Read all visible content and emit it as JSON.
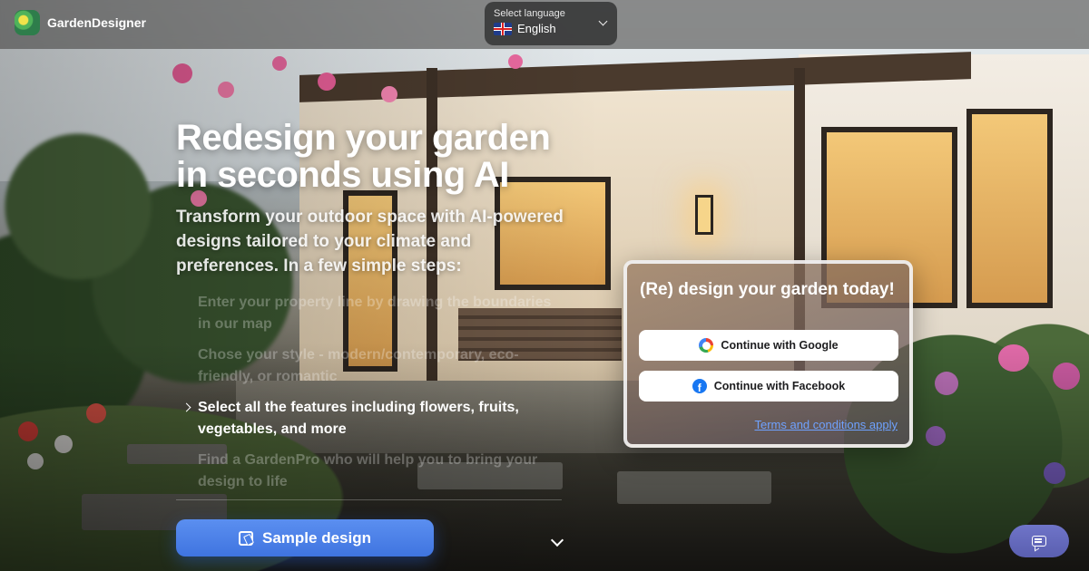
{
  "header": {
    "brand_name": "GardenDesigner",
    "logo_icon": "garden-designer-logo",
    "language": {
      "label": "Select language",
      "value": "English",
      "flag_icon": "uk-flag-icon"
    }
  },
  "hero": {
    "title": "Redesign your garden in seconds using AI",
    "subtitle": "Transform your outdoor space with AI-powered designs tailored to your climate and preferences. In a few simple steps:",
    "steps": [
      {
        "text": "Enter your property line by drawing the boundaries in our map",
        "active": false
      },
      {
        "text": "Chose your style - modern/contemporary, eco-friendly, or romantic",
        "active": false
      },
      {
        "text": "Select all the features including flowers, fruits, vegetables, and more",
        "active": true
      },
      {
        "text": "Find a GardenPro who will help you to bring your design to life",
        "active": false
      }
    ],
    "sample_button": "Sample design"
  },
  "auth_card": {
    "title": "(Re) design your garden today!",
    "google_button": "Continue with Google",
    "facebook_button": "Continue with Facebook",
    "terms_link": "Terms and conditions apply"
  },
  "colors": {
    "primary_button": "#4a80e6",
    "link": "#6fa2ff",
    "chat_button": "#6368bc"
  }
}
